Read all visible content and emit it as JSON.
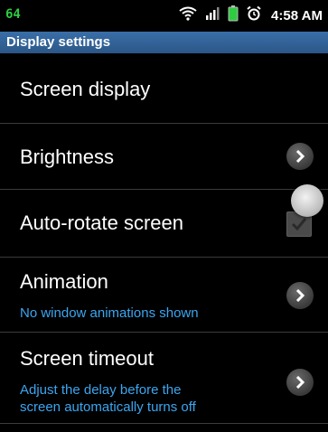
{
  "status_bar": {
    "left_text": "64",
    "time": "4:58 AM",
    "icons": [
      "wifi-icon",
      "signal-icon",
      "battery-icon",
      "alarm-icon"
    ]
  },
  "title": "Display settings",
  "items": [
    {
      "label": "Screen display"
    },
    {
      "label": "Brightness",
      "control": "chevron"
    },
    {
      "label": "Auto-rotate screen",
      "control": "checkbox",
      "checked": true
    },
    {
      "label": "Animation",
      "sub": "No window animations shown",
      "control": "chevron"
    },
    {
      "label": "Screen timeout",
      "sub": [
        "Adjust the delay before the",
        "screen automatically turns off"
      ],
      "control": "chevron"
    }
  ],
  "colors": {
    "title_bar": "#2f5f93",
    "subtitle": "#3ba6f0",
    "status_green": "#2ecc40"
  }
}
